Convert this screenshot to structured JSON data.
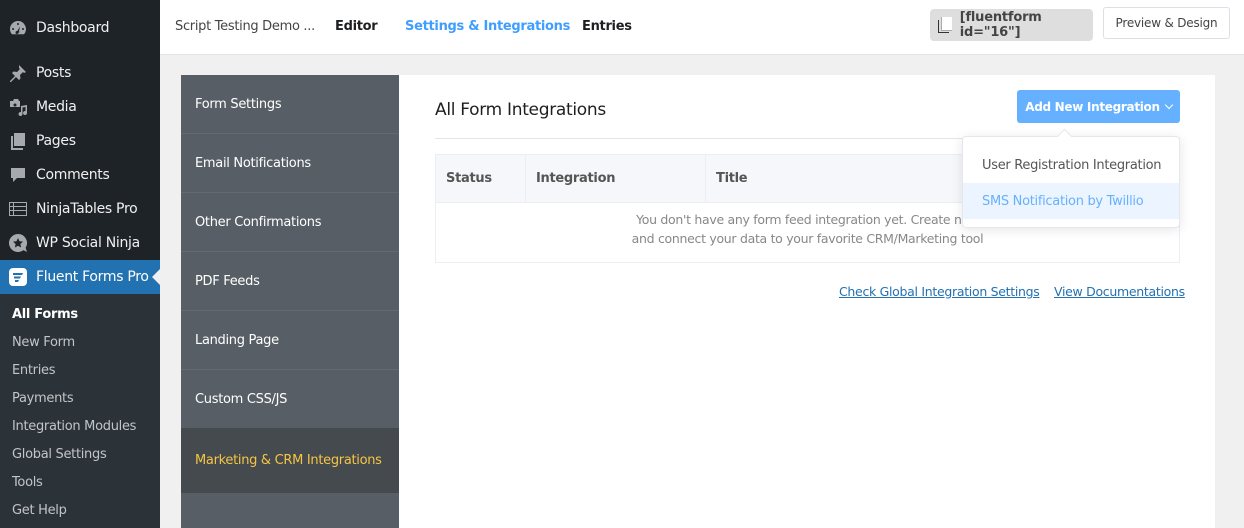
{
  "wp_menu": {
    "items": [
      {
        "label": "Dashboard",
        "icon": "dashboard-icon"
      },
      {
        "label": "Posts",
        "icon": "pin-icon"
      },
      {
        "label": "Media",
        "icon": "media-icon"
      },
      {
        "label": "Pages",
        "icon": "pages-icon"
      },
      {
        "label": "Comments",
        "icon": "comment-icon"
      },
      {
        "label": "NinjaTables Pro",
        "icon": "table-icon"
      },
      {
        "label": "WP Social Ninja",
        "icon": "star-bubble-icon"
      },
      {
        "label": "Fluent Forms Pro",
        "icon": "fluent-forms-icon",
        "active": true
      }
    ],
    "submenu": [
      {
        "label": "All Forms",
        "current": true
      },
      {
        "label": "New Form"
      },
      {
        "label": "Entries"
      },
      {
        "label": "Payments"
      },
      {
        "label": "Integration Modules"
      },
      {
        "label": "Global Settings"
      },
      {
        "label": "Tools"
      },
      {
        "label": "Get Help"
      }
    ]
  },
  "topbar": {
    "form_name": "Script Testing Demo ...",
    "tabs": [
      {
        "label": "Editor"
      },
      {
        "label": "Settings & Integrations",
        "active": true
      },
      {
        "label": "Entries"
      }
    ],
    "shortcode": "[fluentform id=\"16\"]",
    "preview_label": "Preview & Design"
  },
  "settings_nav": {
    "items": [
      {
        "label": "Form Settings"
      },
      {
        "label": "Email Notifications"
      },
      {
        "label": "Other Confirmations"
      },
      {
        "label": "PDF Feeds"
      },
      {
        "label": "Landing Page"
      },
      {
        "label": "Custom CSS/JS"
      },
      {
        "label": "Marketing & CRM Integrations",
        "active": true
      }
    ]
  },
  "main": {
    "title": "All Form Integrations",
    "add_button": "Add New Integration",
    "table": {
      "columns": [
        "Status",
        "Integration",
        "Title"
      ],
      "empty_line1": "You don't have any form feed integration yet. Create new",
      "empty_line2": "and connect your data to your favorite CRM/Marketing tool"
    },
    "links": {
      "global_settings": "Check Global Integration Settings",
      "docs": "View Documentations"
    },
    "dropdown": [
      {
        "label": "User Registration Integration"
      },
      {
        "label": "SMS Notification by Twillio",
        "hover": true
      }
    ]
  },
  "colors": {
    "wp_active": "#2271b1",
    "accent_blue": "#409eff",
    "button_blue": "#66b1ff",
    "nav_active_text": "#f5c544"
  }
}
